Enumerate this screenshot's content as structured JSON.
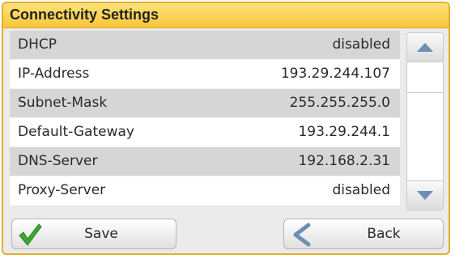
{
  "window": {
    "title": "Connectivity Settings"
  },
  "settings": [
    {
      "label": "DHCP",
      "value": "disabled"
    },
    {
      "label": "IP-Address",
      "value": "193.29.244.107"
    },
    {
      "label": "Subnet-Mask",
      "value": "255.255.255.0"
    },
    {
      "label": "Default-Gateway",
      "value": "193.29.244.1"
    },
    {
      "label": "DNS-Server",
      "value": "192.168.2.31"
    },
    {
      "label": "Proxy-Server",
      "value": "disabled"
    }
  ],
  "scrollbar": {
    "up_icon": "chevron-up-icon",
    "down_icon": "chevron-down-icon"
  },
  "buttons": {
    "save_label": "Save",
    "save_icon": "checkmark-icon",
    "back_label": "Back",
    "back_icon": "back-arrow-icon"
  },
  "colors": {
    "title_bar": "#f7c63b",
    "accent_arrow": "#6d8fb3",
    "check_green": "#3aa832",
    "row_alt": "#d6d6d6"
  }
}
